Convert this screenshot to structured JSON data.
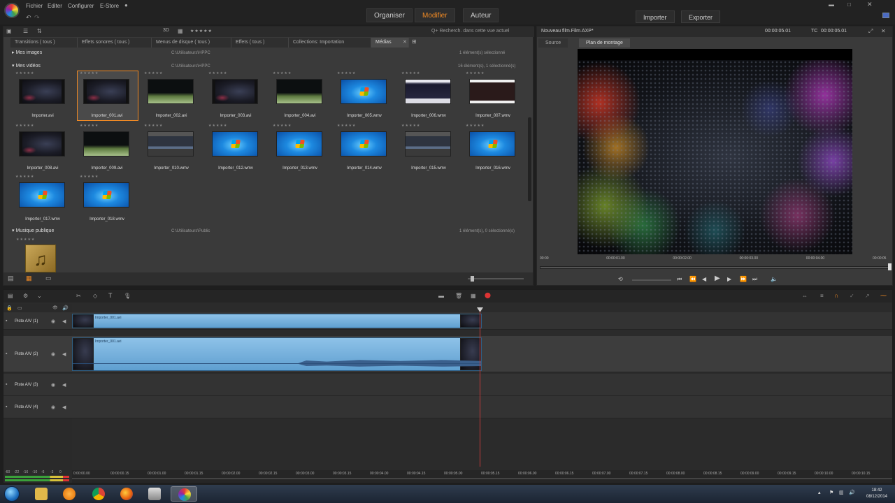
{
  "menu": {
    "items": [
      "Fichier",
      "Editer",
      "Configurer",
      "E-Store"
    ],
    "modes": [
      "Organiser",
      "Modifier",
      "Auteur"
    ],
    "active_mode": "Modifier",
    "import_label": "Importer",
    "export_label": "Exporter"
  },
  "library": {
    "search_placeholder": "Q+ Recherch. dans cette vue actuel",
    "tabs": [
      "Transitions ( tous )",
      "Effets sonores ( tous )",
      "Menus de disque ( tous )",
      "Effets ( tous )",
      "Collections: Importation",
      "Médias"
    ],
    "active_tab": "Médias",
    "sections": [
      {
        "title": "Mes images",
        "path": "C:\\Utilisateurs\\HPPC",
        "count": "1 élément(s) sélectionné"
      },
      {
        "title": "Mes vidéos",
        "path": "C:\\Utilisateurs\\HPPC",
        "count": "16 élément(s), 1 sélectionné(s)"
      },
      {
        "title": "Musique publique",
        "path": "C:\\Utilisateurs\\Public",
        "count": "1 élément(s), 0 sélectionné(s)"
      }
    ],
    "videos": [
      {
        "name": "Importer.avi",
        "kind": "dark"
      },
      {
        "name": "Importer_001.avi",
        "kind": "dark",
        "selected": true
      },
      {
        "name": "Importer_002.avi",
        "kind": "green"
      },
      {
        "name": "Importer_003.avi",
        "kind": "dark"
      },
      {
        "name": "Importer_004.avi",
        "kind": "green"
      },
      {
        "name": "Importer_005.wmv",
        "kind": "win"
      },
      {
        "name": "Importer_006.wmv",
        "kind": "shot"
      },
      {
        "name": "Importer_007.wmv",
        "kind": "shot2"
      },
      {
        "name": "Importer_008.avi",
        "kind": "dark"
      },
      {
        "name": "Importer_009.avi",
        "kind": "green"
      },
      {
        "name": "Importer_010.wmv",
        "kind": "ui"
      },
      {
        "name": "Importer_012.wmv",
        "kind": "win"
      },
      {
        "name": "Importer_013.wmv",
        "kind": "win"
      },
      {
        "name": "Importer_014.wmv",
        "kind": "win"
      },
      {
        "name": "Importer_015.wmv",
        "kind": "ui"
      },
      {
        "name": "Importer_016.wmv",
        "kind": "win"
      },
      {
        "name": "Importer_017.wmv",
        "kind": "win"
      },
      {
        "name": "Importer_018.wmv",
        "kind": "win"
      }
    ]
  },
  "preview": {
    "title": "Nouveau film.Film.AXP*",
    "timecode_left": "00:00:05.01",
    "tc_label": "TC",
    "timecode_right": "00:00:05.01",
    "tabs": [
      "Source",
      "Plan de montage"
    ],
    "active_tab": "Plan de montage",
    "ruler_ticks": [
      "00:00",
      "00:00:01.00",
      "00:00:02.00",
      "00:00:03.00",
      "00:00:04.00",
      "00:00:05"
    ]
  },
  "timeline": {
    "tracks": [
      {
        "name": "Piste A/V (1)",
        "clip": "Importer_001.avi"
      },
      {
        "name": "Piste A/V (2)",
        "clip": "Importer_001.avi"
      },
      {
        "name": "Piste A/V (3)",
        "clip": ""
      },
      {
        "name": "Piste A/V (4)",
        "clip": ""
      }
    ],
    "ruler_ticks": [
      "0:00:00.00",
      "00:00:00.15",
      "00:00:01.00",
      "00:00:01.15",
      "00:00:02.00",
      "00:00:02.15",
      "00:00:03.00",
      "00:00:03.15",
      "00:00:04.00",
      "00:00:04.15",
      "00:00:05.00",
      "00:00:05.15",
      "00:00:06.00",
      "00:00:06.15",
      "00:00:07.00",
      "00:00:07.15",
      "00:00:08.00",
      "00:00:08.15",
      "00:00:09.00",
      "00:00:09.15",
      "00:00:10.00",
      "00:00:10.15"
    ],
    "vu_labels": [
      "-60",
      "-22",
      "-16",
      "-10",
      "-6",
      "-3",
      "0"
    ]
  },
  "taskbar": {
    "time": "18:42",
    "date": "08/12/2014"
  },
  "colors": {
    "accent": "#f08a24",
    "clip": "#6aa9d8",
    "playhead": "#c23a3a"
  }
}
